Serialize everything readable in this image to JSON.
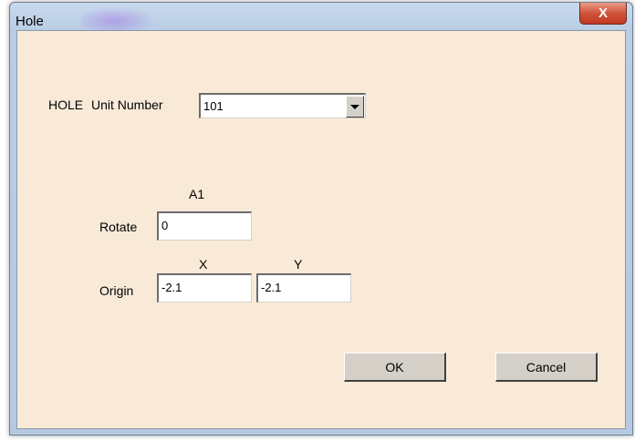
{
  "window": {
    "title": "Hole",
    "close_glyph": "X"
  },
  "form": {
    "hole_label": "HOLE",
    "unit_number_label": "Unit Number",
    "unit_number_value": "101",
    "a1_label": "A1",
    "rotate_label": "Rotate",
    "rotate_value": "0",
    "x_label": "X",
    "y_label": "Y",
    "origin_label": "Origin",
    "origin_x_value": "-2.1",
    "origin_y_value": "-2.1"
  },
  "buttons": {
    "ok_label": "OK",
    "cancel_label": "Cancel"
  },
  "icons": {
    "close": "close-icon",
    "dropdown": "chevron-down-icon"
  }
}
